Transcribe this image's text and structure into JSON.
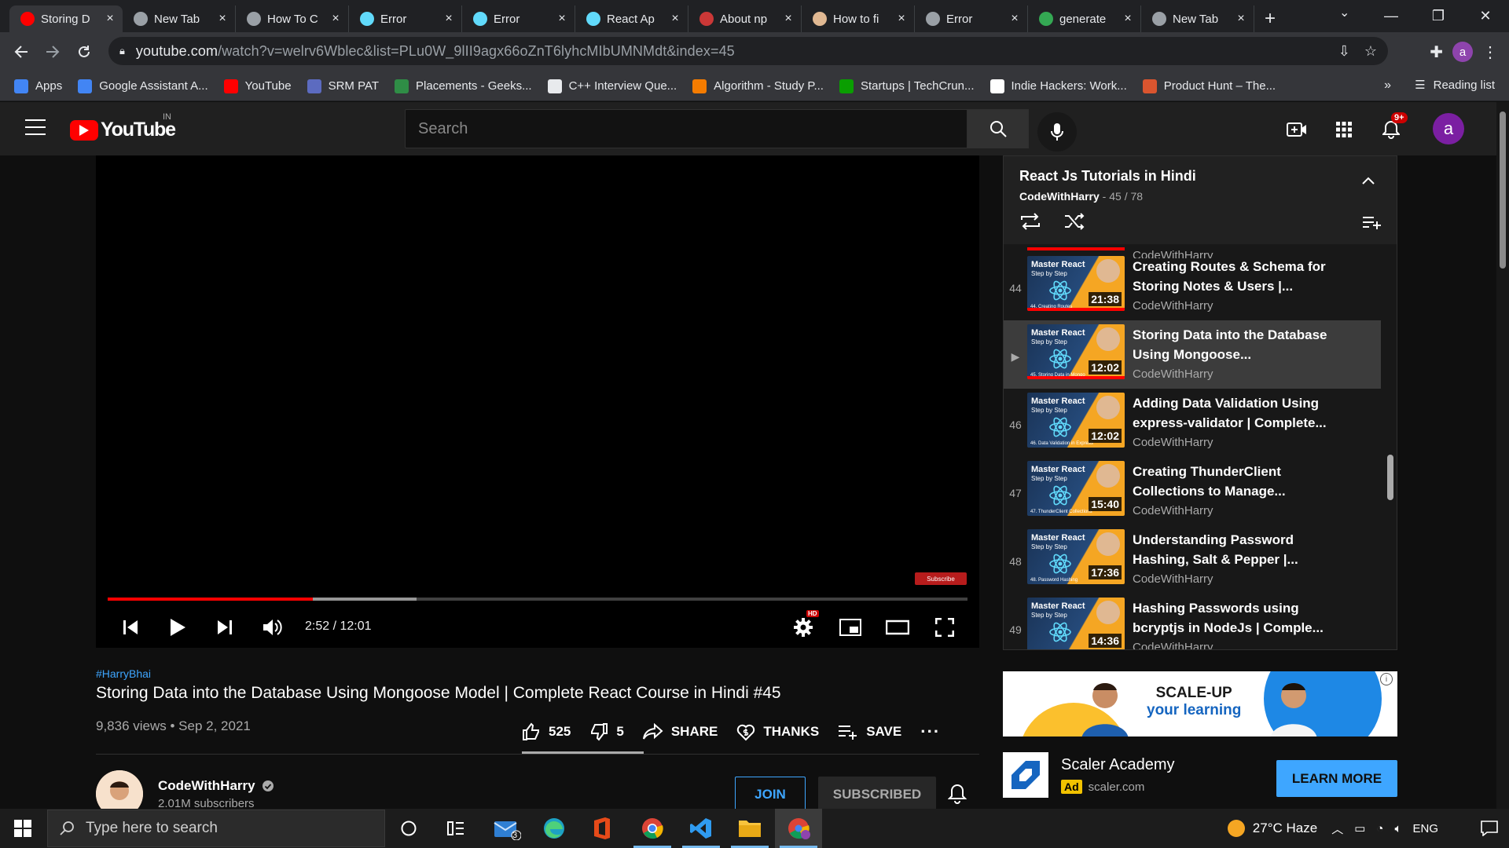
{
  "browser": {
    "tabs": [
      {
        "title": "Storing D",
        "favicon": "youtube-icon",
        "color": "#ff0000",
        "active": true
      },
      {
        "title": "New Tab",
        "favicon": "chrome-icon",
        "color": "#9aa0a6",
        "active": false
      },
      {
        "title": "How To C",
        "favicon": "geeks-icon",
        "color": "#9aa0a6",
        "active": false
      },
      {
        "title": "Error",
        "favicon": "react-icon",
        "color": "#61dafb",
        "active": false
      },
      {
        "title": "Error",
        "favicon": "react-icon",
        "color": "#61dafb",
        "active": false
      },
      {
        "title": "React Ap",
        "favicon": "react-icon",
        "color": "#61dafb",
        "active": false
      },
      {
        "title": "About np",
        "favicon": "npm-icon",
        "color": "#cb3837",
        "active": false
      },
      {
        "title": "How to fi",
        "favicon": "avatar-icon",
        "color": "#e0b892",
        "active": false
      },
      {
        "title": "Error",
        "favicon": "globe-icon",
        "color": "#9aa0a6",
        "active": false
      },
      {
        "title": "generate",
        "favicon": "tool-icon",
        "color": "#34a853",
        "active": false
      },
      {
        "title": "New Tab",
        "favicon": "chrome-icon",
        "color": "#9aa0a6",
        "active": false
      }
    ],
    "url_host": "youtube.com",
    "url_rest": "/watch?v=welrv6Wblec&list=PLu0W_9lII9agx66oZnT6lyhcMIbUMNMdt&index=45",
    "profile_letter": "a",
    "bookmarks": [
      {
        "label": "Apps",
        "color": "#4285f4",
        "icon": "apps-grid-icon"
      },
      {
        "label": "Google Assistant A...",
        "color": "#4285f4",
        "icon": "assistant-icon"
      },
      {
        "label": "YouTube",
        "color": "#ff0000",
        "icon": "youtube-icon"
      },
      {
        "label": "SRM PAT",
        "color": "#5c6bc0",
        "icon": "srm-icon"
      },
      {
        "label": "Placements - Geeks...",
        "color": "#2f8d46",
        "icon": "geeks-icon"
      },
      {
        "label": "C++ Interview Que...",
        "color": "#e8eaed",
        "icon": "mountain-icon"
      },
      {
        "label": "Algorithm - Study P...",
        "color": "#f57c00",
        "icon": "algorithm-icon"
      },
      {
        "label": "Startups | TechCrun...",
        "color": "#0a9e01",
        "icon": "techcrunch-icon"
      },
      {
        "label": "Indie Hackers: Work...",
        "color": "#ffffff",
        "icon": "indiehackers-icon"
      },
      {
        "label": "Product Hunt – The...",
        "color": "#da552f",
        "icon": "producthunt-icon"
      }
    ],
    "reading_list": "Reading list"
  },
  "youtube": {
    "region": "IN",
    "search_placeholder": "Search",
    "notification_count": "9+",
    "avatar_letter": "a",
    "player": {
      "time": "2:52 / 12:01",
      "watermark": "Subscribe",
      "played_fraction": 0.239,
      "loaded_fraction": 0.359,
      "hd": "HD"
    },
    "video": {
      "hashtag": "#HarryBhai",
      "title": "Storing Data into the Database Using Mongoose Model | Complete React Course in Hindi #45",
      "meta": "9,836 views • Sep 2, 2021",
      "likes": "525",
      "dislikes": "5",
      "share": "SHARE",
      "thanks": "THANKS",
      "save": "SAVE"
    },
    "channel": {
      "name": "CodeWithHarry",
      "subscribers": "2.01M subscribers",
      "join": "JOIN",
      "subscribed": "SUBSCRIBED"
    },
    "playlist": {
      "title": "React Js Tutorials in Hindi",
      "owner": "CodeWithHarry",
      "position": "45 / 78",
      "prev_channel": "CodeWithHarry",
      "items": [
        {
          "index": "44",
          "title": "Creating Routes & Schema for Storing Notes & Users |...",
          "channel": "CodeWithHarry",
          "duration": "21:38",
          "caption": "44. Creating Routes",
          "watched": true,
          "current": false
        },
        {
          "index": "▶",
          "title": "Storing Data into the Database Using Mongoose...",
          "channel": "CodeWithHarry",
          "duration": "12:02",
          "caption": "45. Storing Data in Mongo",
          "watched": true,
          "current": true
        },
        {
          "index": "46",
          "title": "Adding Data Validation Using express-validator | Complete...",
          "channel": "CodeWithHarry",
          "duration": "12:02",
          "caption": "46. Data Validation in Express",
          "watched": false,
          "current": false
        },
        {
          "index": "47",
          "title": "Creating ThunderClient Collections to Manage...",
          "channel": "CodeWithHarry",
          "duration": "15:40",
          "caption": "47. ThunderClient Collections",
          "watched": false,
          "current": false
        },
        {
          "index": "48",
          "title": "Understanding Password Hashing, Salt & Pepper |...",
          "channel": "CodeWithHarry",
          "duration": "17:36",
          "caption": "48. Password Hashing",
          "watched": false,
          "current": false
        },
        {
          "index": "49",
          "title": "Hashing Passwords using bcryptjs in NodeJs | Comple...",
          "channel": "CodeWithHarry",
          "duration": "14:36",
          "caption": "",
          "watched": false,
          "current": false
        }
      ],
      "thumb_brand": "Master React",
      "thumb_sub": "Step by Step"
    },
    "ad": {
      "headline_1": "SCALE-UP",
      "headline_2": "your learning",
      "name": "Scaler Academy",
      "badge": "Ad",
      "domain": "scaler.com",
      "cta": "LEARN MORE"
    }
  },
  "taskbar": {
    "search_placeholder": "Type here to search",
    "mail_badge": "3",
    "weather": "27°C  Haze",
    "language": "ENG"
  }
}
